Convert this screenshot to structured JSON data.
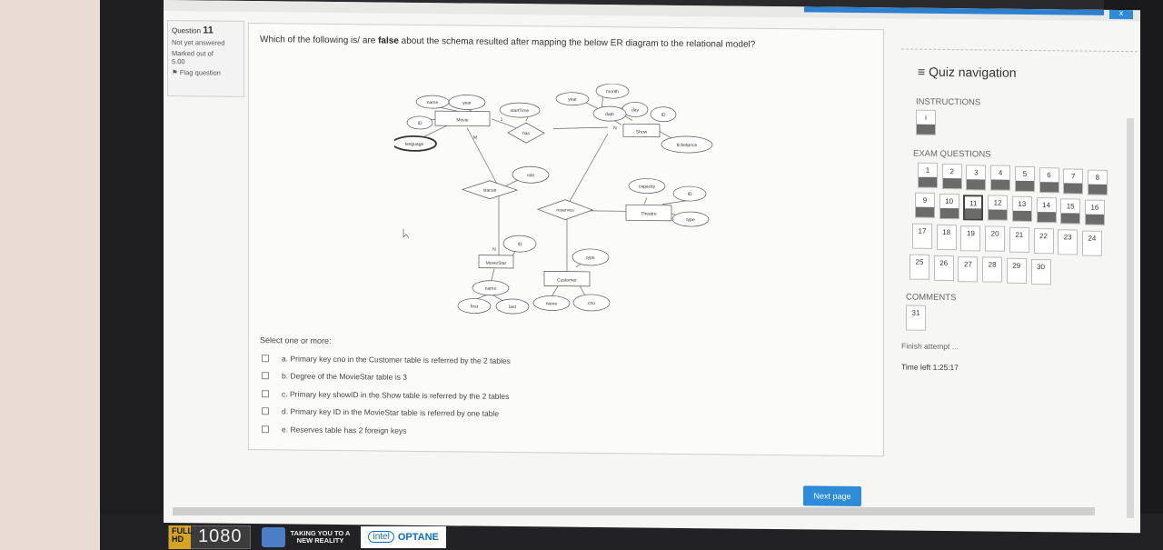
{
  "window": {
    "close_label": "x"
  },
  "question_info": {
    "label": "Question",
    "number": "11",
    "status": "Not yet answered",
    "marked": "Marked out of",
    "marked_value": "5.00",
    "flag": "Flag question"
  },
  "question": {
    "text_before": "Which of the following is/ are ",
    "text_bold": "false",
    "text_after": " about the schema resulted after mapping the below ER diagram to the relational model?"
  },
  "er_diagram": {
    "entities": [
      "Movie",
      "Show",
      "Theatre",
      "MovieStar",
      "Customer"
    ],
    "relationships": [
      "has",
      "starsin",
      "reserves"
    ],
    "attributes": [
      "name",
      "year",
      "ID",
      "language",
      "startTime",
      "year",
      "month",
      "day",
      "date",
      "ID",
      "ticketprice",
      "role",
      "capacity",
      "ID",
      "type",
      "ID",
      "type",
      "name",
      "first",
      "last",
      "name",
      "cno"
    ],
    "cardinalities": [
      "1",
      "N",
      "M",
      "N"
    ]
  },
  "answer": {
    "select_label": "Select one or more:",
    "options": [
      "a. Primary key cno in the Customer table is referred by the 2 tables",
      "b. Degree of the MovieStar table is 3",
      "c. Primary key showID in the Show table is referred by the 2 tables",
      "d. Primary key ID in the MovieStar table is referred by one table",
      "e. Reserves table has 2 foreign keys"
    ]
  },
  "next_button": "Next page",
  "quiz_nav": {
    "title": "Quiz navigation",
    "instructions_label": "INSTRUCTIONS",
    "instructions_item": "i",
    "exam_label": "EXAM QUESTIONS",
    "exam_items": [
      "1",
      "2",
      "3",
      "4",
      "5",
      "6",
      "7",
      "8",
      "9",
      "10",
      "11",
      "12",
      "13",
      "14",
      "15",
      "16",
      "17",
      "18",
      "19",
      "20",
      "21",
      "22",
      "23",
      "24",
      "25",
      "26",
      "27",
      "28",
      "29",
      "30"
    ],
    "current_item": "11",
    "comments_label": "COMMENTS",
    "comments_item": "31",
    "finish_attempt": "Finish attempt ...",
    "time_left_label": "Time left",
    "time_left_value": "1:25:17"
  },
  "badges": {
    "full": "FULL",
    "hd": "HD",
    "resolution": "1080",
    "tagline_1": "TAKING YOU TO A",
    "tagline_2": "NEW REALITY",
    "intel": "intel",
    "optane": "OPTANE"
  },
  "colors": {
    "accent": "#2d8bd8",
    "answered": "#6b6b6b"
  }
}
